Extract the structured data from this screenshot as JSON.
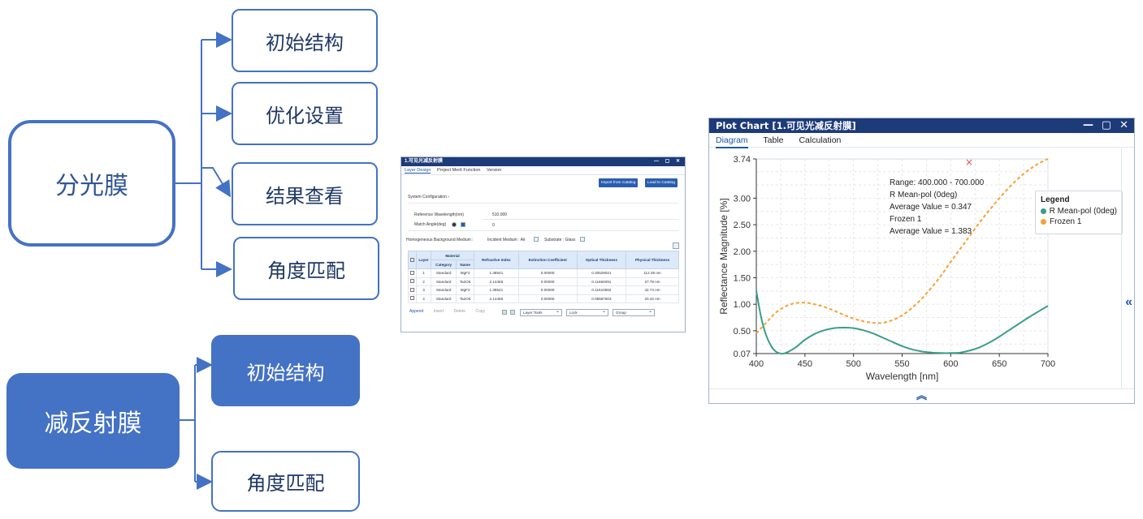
{
  "mindmap": {
    "root1": {
      "label": "分光膜",
      "children": [
        "初始结构",
        "优化设置",
        "结果查看",
        "角度匹配"
      ]
    },
    "root2": {
      "label": "减反射膜",
      "children": [
        "初始结构",
        "角度匹配"
      ]
    },
    "color": "#4472c4"
  },
  "layer_design": {
    "title": "1.可见光减反射膜",
    "window_controls": "— ▢ ✕",
    "tabs": [
      "Layer Design",
      "Project Merit Function",
      "Version"
    ],
    "buttons": {
      "import": "Import from Catalog",
      "load": "Load to Catalog"
    },
    "system_config": "System Configuration",
    "ref_wavelength": {
      "label": "Reference Wavelength(nm)",
      "value": "510.000"
    },
    "match_angle": {
      "label": "Match Angle(deg)",
      "value": "0"
    },
    "media": {
      "bg": "Homogeneous Background Medium :",
      "incident": "Incident Medium : Air",
      "substrate": "Substrate : Glass"
    },
    "table": {
      "headers": {
        "layer": "Layer",
        "material": "Material",
        "category": "Category",
        "name": "Name",
        "ri": "Refractive Index",
        "ec": "Extinction Coefficient",
        "ot": "Optical Thickness",
        "pt": "Physical Thickness"
      },
      "rows": [
        [
          "1",
          "Standard",
          "MgF2",
          "1.38541",
          "0.00000",
          "0.30529021",
          "112.38 nm"
        ],
        [
          "2",
          "Standard",
          "Ta2O5",
          "2.14455",
          "0.00000",
          "0.11684091",
          "27.79 nm"
        ],
        [
          "3",
          "Standard",
          "MgF2",
          "1.38541",
          "0.00000",
          "0.11610662",
          "42.74 nm"
        ],
        [
          "4",
          "Standard",
          "Ta2O5",
          "2.14455",
          "0.00000",
          "0.08587603",
          "20.42 nm"
        ]
      ]
    },
    "footer": {
      "actions": [
        "Append",
        "Insert",
        "Delete",
        "Copy"
      ],
      "selects": [
        "Layer Tools",
        "Lock",
        "Group"
      ]
    }
  },
  "plot_chart": {
    "title": "Plot Chart [1.可见光减反射膜]",
    "controls": {
      "min": "—",
      "max": "▢",
      "close": "✕"
    },
    "tabs": [
      "Diagram",
      "Table",
      "Calculation"
    ],
    "side_toggle": "«",
    "bottom_toggle": "︽",
    "annotation": [
      "Range: 400.000 - 700.000",
      "R Mean-pol (0deg)",
      "Average Value = 0.347",
      "Frozen 1",
      "Average Value = 1.383"
    ],
    "marker": "×",
    "legend": {
      "title": "Legend",
      "items": [
        {
          "name": "R Mean-pol (0deg)",
          "color": "#3a9e8a"
        },
        {
          "name": "Frozen 1",
          "color": "#f4a234"
        }
      ]
    }
  },
  "chart_data": {
    "type": "line",
    "title": "",
    "xlabel": "Wavelength [nm]",
    "ylabel": "Reflectance Magnitude [%]",
    "xlim": [
      400,
      700
    ],
    "ylim": [
      0.07,
      3.74
    ],
    "xticks": [
      400,
      450,
      500,
      550,
      600,
      650,
      700
    ],
    "yticks": [
      0.07,
      0.5,
      1.0,
      1.5,
      2.0,
      2.5,
      3.0,
      3.74
    ],
    "ytick_labels": [
      "0.07",
      "0.50",
      "1.00",
      "1.50",
      "2.00",
      "2.50",
      "3.00",
      "3.74"
    ],
    "grid": true,
    "legend_position": "right",
    "series": [
      {
        "name": "R Mean-pol (0deg)",
        "color": "#3a9e8a",
        "style": "solid",
        "x": [
          400,
          405,
          410,
          415,
          420,
          425,
          430,
          440,
          450,
          460,
          470,
          480,
          490,
          500,
          510,
          520,
          530,
          540,
          550,
          560,
          570,
          580,
          590,
          600,
          610,
          620,
          630,
          640,
          650,
          660,
          670,
          680,
          690,
          700
        ],
        "y": [
          1.25,
          0.75,
          0.42,
          0.22,
          0.11,
          0.07,
          0.08,
          0.18,
          0.33,
          0.44,
          0.51,
          0.55,
          0.56,
          0.55,
          0.51,
          0.45,
          0.37,
          0.29,
          0.21,
          0.15,
          0.11,
          0.09,
          0.08,
          0.08,
          0.09,
          0.13,
          0.19,
          0.28,
          0.39,
          0.51,
          0.63,
          0.75,
          0.86,
          0.97
        ]
      },
      {
        "name": "Frozen 1",
        "color": "#f4a234",
        "style": "dashed",
        "x": [
          400,
          410,
          420,
          430,
          440,
          450,
          460,
          470,
          480,
          490,
          500,
          510,
          520,
          530,
          540,
          550,
          560,
          570,
          580,
          590,
          600,
          610,
          620,
          630,
          640,
          650,
          660,
          670,
          680,
          690,
          700
        ],
        "y": [
          0.45,
          0.65,
          0.84,
          0.96,
          1.02,
          1.03,
          1.0,
          0.95,
          0.88,
          0.8,
          0.73,
          0.68,
          0.65,
          0.65,
          0.7,
          0.79,
          0.93,
          1.1,
          1.31,
          1.54,
          1.8,
          2.05,
          2.3,
          2.55,
          2.78,
          3.0,
          3.2,
          3.38,
          3.53,
          3.65,
          3.74
        ]
      }
    ]
  }
}
